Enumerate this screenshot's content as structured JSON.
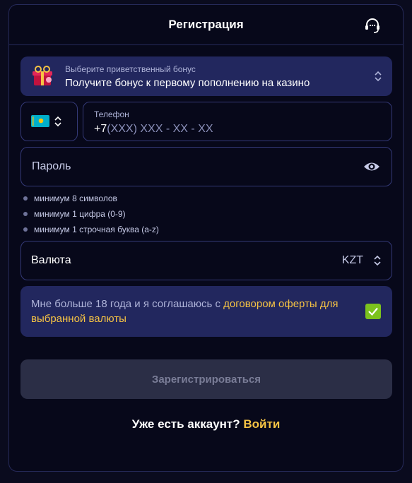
{
  "header": {
    "title": "Регистрация",
    "support_icon": "support-headset-icon"
  },
  "bonus": {
    "label": "Выберите приветственный бонус",
    "value": "Получите бонус к первому пополнению на казино",
    "icon": "gift-icon"
  },
  "phone": {
    "country_flag": "kazakhstan-flag",
    "label": "Телефон",
    "prefix": "+7",
    "mask": "(XXX) XXX - XX - XX"
  },
  "password": {
    "placeholder": "Пароль",
    "icon": "eye-icon",
    "rules": [
      "минимум 8 символов",
      "минимум 1 цифра (0-9)",
      "минимум 1 строчная буква (a-z)"
    ]
  },
  "currency": {
    "label": "Валюта",
    "value": "KZT"
  },
  "agreement": {
    "text": "Мне больше 18 года и я соглашаюсь с ",
    "link": "договором оферты для выбранной валюты",
    "checked": true
  },
  "submit": {
    "label": "Зарегистрироваться"
  },
  "login": {
    "question": "Уже есть аккаунт?",
    "link": "Войти"
  },
  "colors": {
    "background": "#07081a",
    "card": "#22275e",
    "accent": "#f6c344",
    "checkbox": "#7cc21e"
  }
}
